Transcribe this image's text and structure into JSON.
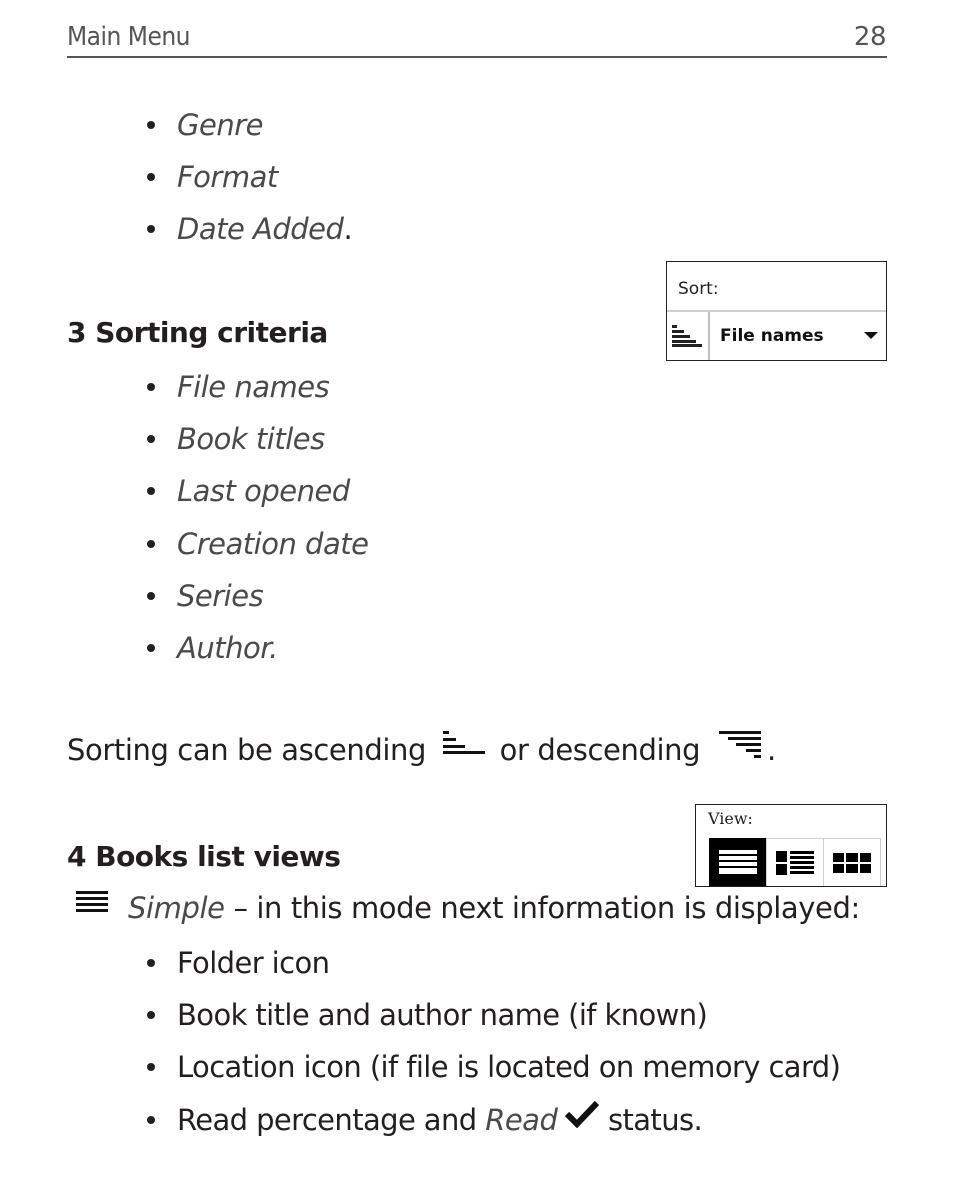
{
  "header": {
    "section_title": "Main Menu",
    "page_number": "28"
  },
  "filter_list": {
    "items": [
      {
        "text": "Genre",
        "suffix": ""
      },
      {
        "text": "Format",
        "suffix": ""
      },
      {
        "text": "Date Added",
        "suffix": "."
      }
    ]
  },
  "sorting": {
    "heading": "3 Sorting criteria",
    "widget": {
      "label": "Sort:",
      "order_icon": "sort-ascending-icon",
      "selected_value": "File names",
      "dropdown_icon": "caret-down-icon"
    },
    "criteria": [
      "File names",
      "Book titles",
      "Last opened",
      "Creation date",
      "Series",
      "Author."
    ],
    "order_sentence": {
      "part1": "Sorting can be ascending",
      "ascending_icon": "sort-ascending-icon",
      "part2": "or descending",
      "descending_icon": "sort-descending-icon",
      "end": "."
    }
  },
  "views": {
    "heading": "4 Books list views",
    "widget": {
      "label": "View:",
      "buttons": [
        {
          "name": "simple-view",
          "icon": "list-simple-icon",
          "active": true
        },
        {
          "name": "detailed-list-view",
          "icon": "list-detailed-icon",
          "active": false
        },
        {
          "name": "thumbnail-view",
          "icon": "grid-icon",
          "active": false
        }
      ]
    },
    "simple": {
      "icon": "list-simple-icon",
      "mode_name": "Simple",
      "description": " – in this mode next information is displayed:"
    },
    "simple_items": [
      {
        "text": "Folder icon"
      },
      {
        "text": "Book title and author name (if known)"
      },
      {
        "text": "Location icon (if file is located on memory card)"
      },
      {
        "prefix": "Read percentage and ",
        "italic": "Read",
        "icon": "checkmark-icon",
        "suffix": " status."
      }
    ]
  }
}
